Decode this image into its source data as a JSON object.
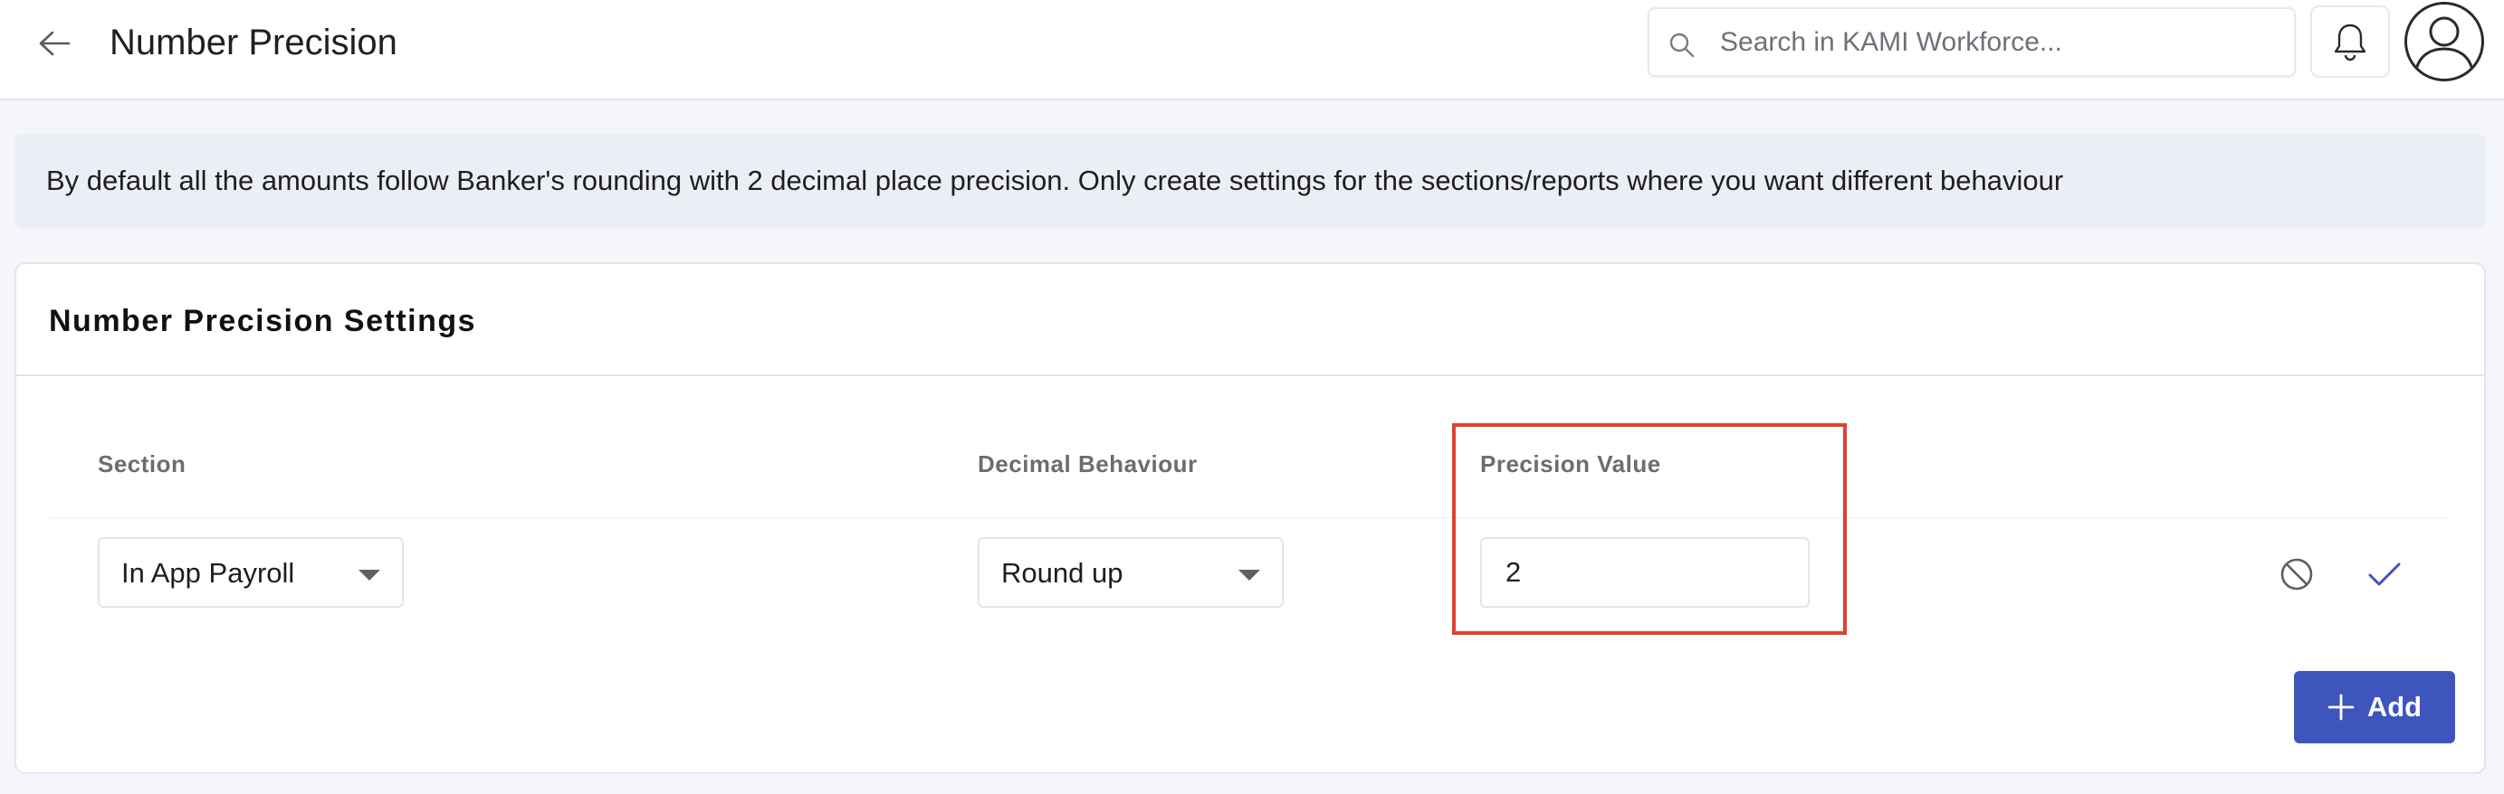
{
  "header": {
    "title": "Number Precision",
    "back_icon": "arrow-left-icon",
    "search": {
      "placeholder": "Search in KAMI Workforce...",
      "value": ""
    },
    "notification_icon": "bell-icon",
    "avatar_icon": "user-avatar-icon"
  },
  "banner": {
    "text": "By default all the amounts follow Banker's rounding with 2 decimal place precision. Only create settings for the sections/reports where you want different behaviour"
  },
  "settings": {
    "title": "Number Precision Settings",
    "columns": {
      "section": "Section",
      "decimal_behaviour": "Decimal Behaviour",
      "precision_value": "Precision Value"
    },
    "row": {
      "section": "In App Payroll",
      "decimal_behaviour": "Round up",
      "precision_value": "2"
    },
    "cancel_icon": "block-icon",
    "confirm_icon": "check-icon",
    "add_label": "Add"
  },
  "colors": {
    "accent": "#3f55be",
    "highlight": "#e0402d",
    "banner_bg": "#eceef6"
  }
}
